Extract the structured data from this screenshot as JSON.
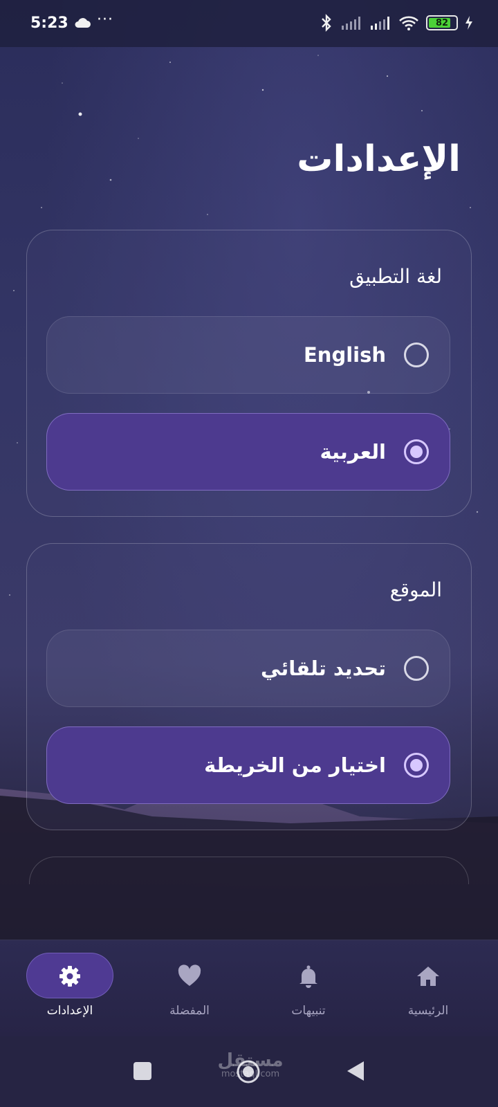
{
  "status_bar": {
    "time": "5:23",
    "more": "···",
    "battery": "82",
    "icons": [
      "cloud-icon",
      "bluetooth-icon",
      "signal-icon",
      "signal-icon",
      "wifi-icon",
      "battery-icon",
      "charging-icon"
    ]
  },
  "page": {
    "title": "الإعدادات"
  },
  "language_section": {
    "title": "لغة التطبيق",
    "options": [
      {
        "label": "English",
        "selected": false
      },
      {
        "label": "العربية",
        "selected": true
      }
    ]
  },
  "location_section": {
    "title": "الموقع",
    "options": [
      {
        "label": "تحديد تلقائي",
        "selected": false
      },
      {
        "label": "اختيار من الخريطة",
        "selected": true
      }
    ]
  },
  "bottom_nav": {
    "items": [
      {
        "label": "الإعدادات",
        "icon": "gear-icon",
        "active": true
      },
      {
        "label": "المفضلة",
        "icon": "heart-icon",
        "active": false
      },
      {
        "label": "تنبيهات",
        "icon": "bell-icon",
        "active": false
      },
      {
        "label": "الرئيسية",
        "icon": "home-icon",
        "active": false
      }
    ]
  },
  "watermark": {
    "text": "مستقل",
    "sub": "mostaql.com"
  },
  "colors": {
    "accent": "#4d3a8f",
    "radio_selected": "#d7c8ff",
    "nav_inactive": "#a9a6c2"
  }
}
